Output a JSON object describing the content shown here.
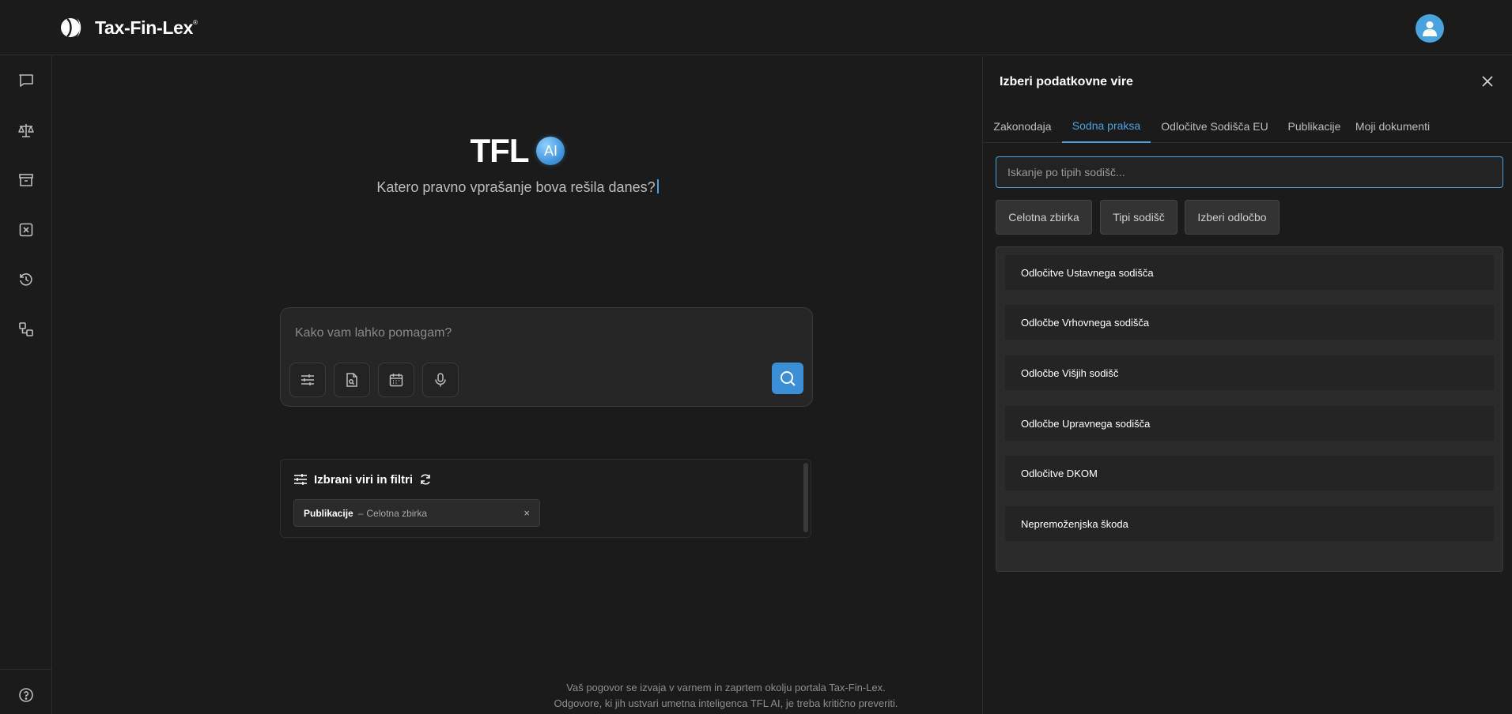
{
  "header": {
    "logo_text": "Tax-Fin-Lex",
    "logo_mark": "®"
  },
  "sidebar": {
    "items": [
      {
        "name": "chat-icon"
      },
      {
        "name": "scales-icon"
      },
      {
        "name": "archive-icon"
      },
      {
        "name": "close-box-icon"
      },
      {
        "name": "history-icon"
      },
      {
        "name": "workflow-icon"
      }
    ],
    "help": {
      "name": "help-icon"
    }
  },
  "hero": {
    "title": "TFL",
    "badge": "AI",
    "subtitle": "Katero pravno vprašanje bova rešila danes?"
  },
  "composer": {
    "placeholder": "Kako vam lahko pomagam?",
    "tools": [
      "sliders-icon",
      "file-search-icon",
      "calendar-icon",
      "microphone-icon"
    ]
  },
  "filters": {
    "title": "Izbrani viri in filtri",
    "chip": {
      "source": "Publikacije",
      "separator": "–",
      "scope": "Celotna zbirka",
      "remove": "×"
    }
  },
  "footer": {
    "line1": "Vaš pogovor se izvaja v varnem in zaprtem okolju portala Tax-Fin-Lex.",
    "line2": "Odgovore, ki jih ustvari umetna inteligenca TFL AI, je treba kritično preveriti."
  },
  "panel": {
    "title": "Izberi podatkovne vire",
    "tabs": [
      "Zakonodaja",
      "Sodna praksa",
      "Odločitve Sodišča EU",
      "Publikacije",
      "Moji dokumenti"
    ],
    "active_tab": "Sodna praksa",
    "search_placeholder": "Iskanje po tipih sodišč...",
    "segments": [
      "Celotna zbirka",
      "Tipi sodišč",
      "Izberi odločbo"
    ],
    "courts": [
      "Odločitve Ustavnega sodišča",
      "Odločbe Vrhovnega sodišča",
      "Odločbe Višjih sodišč",
      "Odločbe Upravnega sodišča",
      "Odločitve DKOM",
      "Nepremoženjska škoda"
    ]
  },
  "colors": {
    "accent": "#4aa3df",
    "background": "#1b1b1b",
    "surface": "#262626"
  }
}
